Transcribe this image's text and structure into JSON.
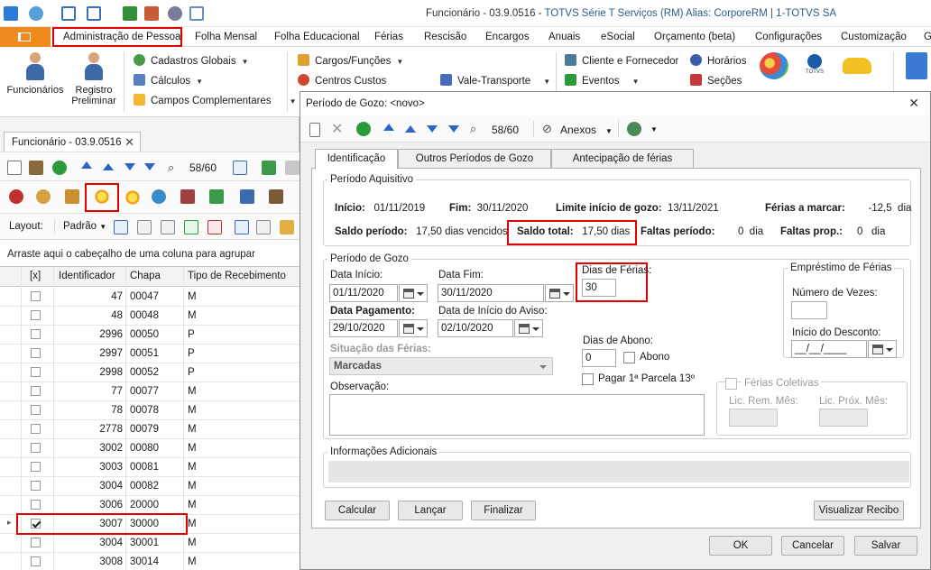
{
  "window": {
    "title": "Funcionário - 03.9.0516 - ",
    "title_brand": "TOTVS Série T Serviços (RM) Alias: CorporeRM | 1-TOTVS SA"
  },
  "ribbon_tabs": [
    "Administração de Pessoal",
    "Folha Mensal",
    "Folha Educacional",
    "Férias",
    "Rescisão",
    "Encargos",
    "Anuais",
    "eSocial",
    "Orçamento (beta)",
    "Configurações",
    "Customização",
    "G"
  ],
  "ribbon": {
    "funcionarios": "Funcionários",
    "registro_line1": "Registro",
    "registro_line2": "Preliminar",
    "cadastros_globais": "Cadastros Globais",
    "calculos": "Cálculos",
    "campos_complementares": "Campos Complementares",
    "cargos_funcoes": "Cargos/Funções",
    "centros_custos": "Centros Custos",
    "vale_transporte": "Vale-Transporte",
    "cliente_fornecedor": "Cliente e Fornecedor",
    "eventos": "Eventos",
    "horarios": "Horários",
    "secoes": "Seções",
    "totvs": "TOTVS"
  },
  "left": {
    "doc_tab": "Funcionário - 03.9.0516",
    "nav_counter": "58/60",
    "layout_label": "Layout:",
    "layout_value": "Padrão",
    "group_hint": "Arraste aqui o cabeçalho de uma coluna para agrupar",
    "columns": [
      "[x]",
      "Identificador",
      "Chapa",
      "Tipo de Recebimento"
    ],
    "rows": [
      {
        "checked": false,
        "id": "47",
        "chapa": "00047",
        "tipo": "M"
      },
      {
        "checked": false,
        "id": "48",
        "chapa": "00048",
        "tipo": "M"
      },
      {
        "checked": false,
        "id": "2996",
        "chapa": "00050",
        "tipo": "P"
      },
      {
        "checked": false,
        "id": "2997",
        "chapa": "00051",
        "tipo": "P"
      },
      {
        "checked": false,
        "id": "2998",
        "chapa": "00052",
        "tipo": "P"
      },
      {
        "checked": false,
        "id": "77",
        "chapa": "00077",
        "tipo": "M"
      },
      {
        "checked": false,
        "id": "78",
        "chapa": "00078",
        "tipo": "M"
      },
      {
        "checked": false,
        "id": "2778",
        "chapa": "00079",
        "tipo": "M"
      },
      {
        "checked": false,
        "id": "3002",
        "chapa": "00080",
        "tipo": "M"
      },
      {
        "checked": false,
        "id": "3003",
        "chapa": "00081",
        "tipo": "M"
      },
      {
        "checked": false,
        "id": "3004",
        "chapa": "00082",
        "tipo": "M"
      },
      {
        "checked": false,
        "id": "3006",
        "chapa": "20000",
        "tipo": "M"
      },
      {
        "checked": true,
        "id": "3007",
        "chapa": "30000",
        "tipo": "M"
      },
      {
        "checked": false,
        "id": "3004",
        "chapa": "30001",
        "tipo": "M"
      },
      {
        "checked": false,
        "id": "3008",
        "chapa": "30014",
        "tipo": "M"
      }
    ]
  },
  "dialog": {
    "title": "Período de Gozo: <novo>",
    "nav_counter": "58/60",
    "anexos": "Anexos",
    "tabs": [
      "Identificação",
      "Outros Períodos de Gozo",
      "Antecipação de férias"
    ],
    "aquisitivo": {
      "legend": "Período Aquisitivo",
      "inicio_label": "Início:",
      "inicio_value": "01/11/2019",
      "fim_label": "Fim:",
      "fim_value": "30/11/2020",
      "limite_label": "Limite início de gozo:",
      "limite_value": "13/11/2021",
      "ferias_marcar_label": "Férias a marcar:",
      "ferias_marcar_value": "-12,5",
      "ferias_marcar_unit": "dia",
      "saldo_periodo_label": "Saldo período:",
      "saldo_periodo_value": "17,50 dias vencidos",
      "saldo_total_label": "Saldo total:",
      "saldo_total_value": "17,50",
      "saldo_total_unit": "dias",
      "faltas_periodo_label": "Faltas período:",
      "faltas_periodo_value": "0",
      "faltas_periodo_unit": "dia",
      "faltas_prop_label": "Faltas prop.:",
      "faltas_prop_value": "0",
      "faltas_prop_unit": "dia"
    },
    "gozo": {
      "legend": "Período de Gozo",
      "data_inicio_label": "Data Início:",
      "data_inicio_value": "01/11/2020",
      "data_fim_label": "Data Fim:",
      "data_fim_value": "30/11/2020",
      "dias_ferias_label": "Dias de Férias:",
      "dias_ferias_value": "30",
      "data_pagamento_label": "Data Pagamento:",
      "data_pagamento_value": "29/10/2020",
      "data_aviso_label": "Data de Início do Aviso:",
      "data_aviso_value": "02/10/2020",
      "dias_abono_label": "Dias de Abono:",
      "dias_abono_value": "0",
      "abono_label": "Abono",
      "situacao_label": "Situação das Férias:",
      "situacao_value": "Marcadas",
      "pagar_parcela_label": "Pagar 1ª Parcela 13º",
      "observacao_label": "Observação:",
      "emprestimo_legend": "Empréstimo de Férias",
      "numero_vezes_label": "Número de Vezes:",
      "inicio_desconto_label": "Início do Desconto:",
      "inicio_desconto_value": "__/__/____",
      "ferias_coletivas_label": "Férias Coletivas",
      "lic_rem_label": "Lic. Rem. Mês:",
      "lic_prox_label": "Lic. Próx. Mês:"
    },
    "info_adicionais": "Informações Adicionais",
    "buttons": {
      "calcular": "Calcular",
      "lancar": "Lançar",
      "finalizar": "Finalizar",
      "visualizar_recibo": "Visualizar Recibo",
      "ok": "OK",
      "cancelar": "Cancelar",
      "salvar": "Salvar"
    }
  },
  "colors": {
    "accent_orange": "#f08a1c",
    "highlight_red": "#e00000",
    "brand_blue": "#2a5c8a"
  }
}
